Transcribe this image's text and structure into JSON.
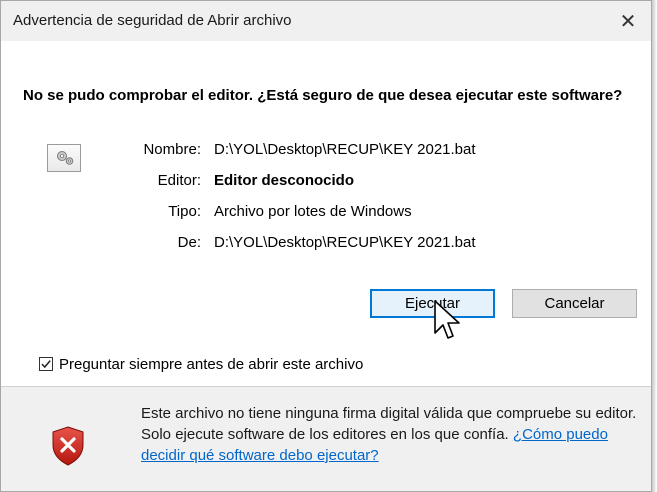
{
  "window": {
    "title": "Advertencia de seguridad de Abrir archivo",
    "close_glyph": "✕"
  },
  "heading": "No se pudo comprobar el editor. ¿Está seguro de que desea ejecutar este software?",
  "details": {
    "name_label": "Nombre:",
    "name_value": "D:\\YOL\\Desktop\\RECUP\\KEY 2021.bat",
    "publisher_label": "Editor:",
    "publisher_value": "Editor desconocido",
    "type_label": "Tipo:",
    "type_value": "Archivo por lotes de Windows",
    "from_label": "De:",
    "from_value": "D:\\YOL\\Desktop\\RECUP\\KEY 2021.bat"
  },
  "buttons": {
    "run_label": "Ejecutar",
    "cancel_label": "Cancelar"
  },
  "checkbox": {
    "label": "Preguntar siempre antes de abrir este archivo",
    "checked": true
  },
  "warning": {
    "text": "Este archivo no tiene ninguna firma digital válida que compruebe su editor. Solo ejecute software de los editores en los que confía.",
    "link": "¿Cómo puedo decidir qué software debo ejecutar?"
  },
  "icons": {
    "file": "batch-file-gears-icon",
    "shield": "shield-error-icon",
    "cursor": "mouse-pointer-icon"
  },
  "colors": {
    "accent": "#0078d7",
    "link": "#0066cc",
    "shield": "#cc2a22"
  }
}
